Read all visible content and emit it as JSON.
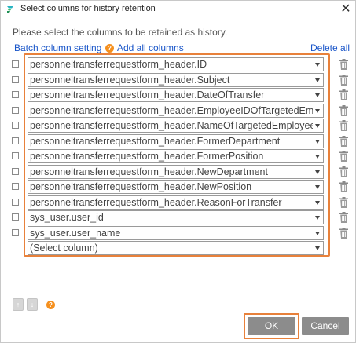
{
  "window": {
    "title": "Select columns for history retention",
    "close_glyph": "✕",
    "icon": "app-logo-icon"
  },
  "instruction": "Please select the columns to be retained as history.",
  "links": {
    "batch_setting": "Batch column setting",
    "help_glyph": "?",
    "add_all": "Add all columns",
    "delete_all": "Delete all"
  },
  "rows": [
    {
      "value": "personneltransferrequestform_header.ID"
    },
    {
      "value": "personneltransferrequestform_header.Subject"
    },
    {
      "value": "personneltransferrequestform_header.DateOfTransfer"
    },
    {
      "value": "personneltransferrequestform_header.EmployeeIDOfTargetedEmplo"
    },
    {
      "value": "personneltransferrequestform_header.NameOfTargetedEmployee"
    },
    {
      "value": "personneltransferrequestform_header.FormerDepartment"
    },
    {
      "value": "personneltransferrequestform_header.FormerPosition"
    },
    {
      "value": "personneltransferrequestform_header.NewDepartment"
    },
    {
      "value": "personneltransferrequestform_header.NewPosition"
    },
    {
      "value": "personneltransferrequestform_header.ReasonForTransfer"
    },
    {
      "value": "sys_user.user_id"
    },
    {
      "value": "sys_user.user_name"
    }
  ],
  "empty_row": {
    "placeholder": "(Select column)"
  },
  "mini_buttons": {
    "up_glyph": "↑",
    "down_glyph": "↓",
    "help_glyph": "?"
  },
  "buttons": {
    "ok": "OK",
    "cancel": "Cancel"
  },
  "colors": {
    "accent_highlight": "#e8813b",
    "link": "#1a56c9",
    "help_badge": "#f5901e",
    "button_bg": "#8c8c8c"
  }
}
